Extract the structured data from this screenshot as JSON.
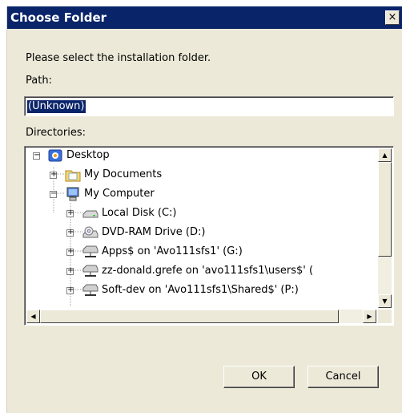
{
  "window": {
    "title": "Choose Folder",
    "close_label": "×"
  },
  "instruction": "Please select the installation folder.",
  "path": {
    "label": "Path:",
    "value": "(Unknown)"
  },
  "directories": {
    "label": "Directories:",
    "items": [
      {
        "label": "Desktop",
        "icon": "desktop-icon",
        "expander": "−"
      },
      {
        "label": "My Documents",
        "icon": "my-documents-icon",
        "expander": "+"
      },
      {
        "label": "My Computer",
        "icon": "my-computer-icon",
        "expander": "−"
      },
      {
        "label": "Local Disk (C:)",
        "icon": "local-disk-icon",
        "expander": "+"
      },
      {
        "label": "DVD-RAM Drive (D:)",
        "icon": "dvd-drive-icon",
        "expander": "+"
      },
      {
        "label": "Apps$ on 'Avo111sfs1' (G:)",
        "icon": "network-drive-icon",
        "expander": "+"
      },
      {
        "label": "zz-donald.grefe on 'avo111sfs1\\users$' (",
        "icon": "network-drive-icon",
        "expander": "+"
      },
      {
        "label": "Soft-dev on 'Avo111sfs1\\Shared$' (P:)",
        "icon": "network-drive-icon",
        "expander": "+"
      }
    ]
  },
  "buttons": {
    "ok": "OK",
    "cancel": "Cancel"
  },
  "colors": {
    "titlebar": "#0a246a",
    "dialog_bg": "#ece9d8",
    "selection": "#0a246a"
  }
}
